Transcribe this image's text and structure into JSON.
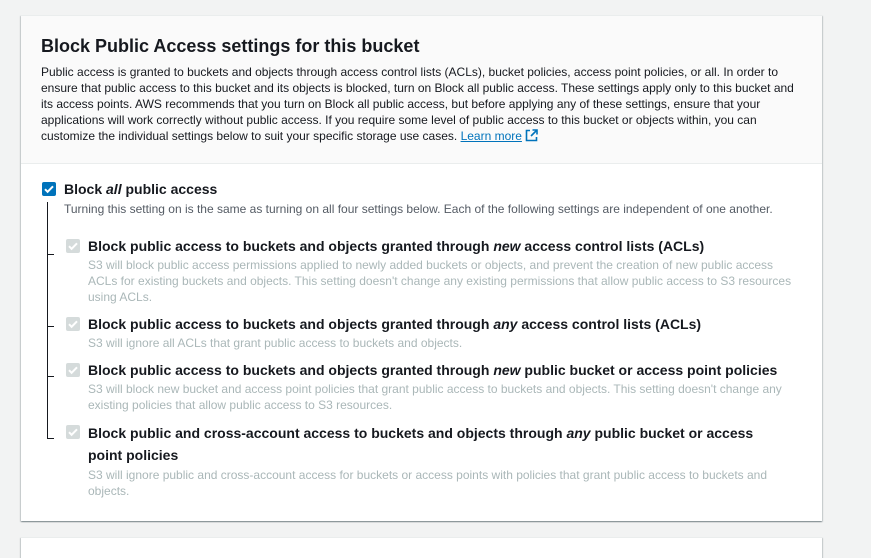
{
  "header": {
    "title": "Block Public Access settings for this bucket",
    "description": "Public access is granted to buckets and objects through access control lists (ACLs), bucket policies, access point policies, or all. In order to ensure that public access to this bucket and its objects is blocked, turn on Block all public access. These settings apply only to this bucket and its access points. AWS recommends that you turn on Block all public access, but before applying any of these settings, ensure that your applications will work correctly without public access. If you require some level of public access to this bucket or objects within, you can customize the individual settings below to suit your specific storage use cases.",
    "learn_more": "Learn more"
  },
  "master": {
    "label_pre": "Block ",
    "label_em": "all",
    "label_post": " public access",
    "description": "Turning this setting on is the same as turning on all four settings below. Each of the following settings are independent of one another.",
    "checked": true
  },
  "settings": [
    {
      "label_pre": "Block public access to buckets and objects granted through ",
      "label_em": "new",
      "label_post": " access control lists (ACLs)",
      "description": "S3 will block public access permissions applied to newly added buckets or objects, and prevent the creation of new public access ACLs for existing buckets and objects. This setting doesn't change any existing permissions that allow public access to S3 resources using ACLs.",
      "checked": true,
      "disabled": true
    },
    {
      "label_pre": "Block public access to buckets and objects granted through ",
      "label_em": "any",
      "label_post": " access control lists (ACLs)",
      "description": "S3 will ignore all ACLs that grant public access to buckets and objects.",
      "checked": true,
      "disabled": true
    },
    {
      "label_pre": "Block public access to buckets and objects granted through ",
      "label_em": "new",
      "label_post": " public bucket or access point policies",
      "description": "S3 will block new bucket and access point policies that grant public access to buckets and objects. This setting doesn't change any existing policies that allow public access to S3 resources.",
      "checked": true,
      "disabled": true
    },
    {
      "label_pre": "Block public and cross-account access to buckets and objects through ",
      "label_em": "any",
      "label_post": " public bucket or access point policies",
      "description": "S3 will ignore public and cross-account access for buckets or access points with policies that grant public access to buckets and objects.",
      "checked": true,
      "disabled": true
    }
  ],
  "colors": {
    "accent": "#0073bb",
    "disabled_checkbox": "#d5dbdb",
    "disabled_text": "#aab7b8"
  }
}
